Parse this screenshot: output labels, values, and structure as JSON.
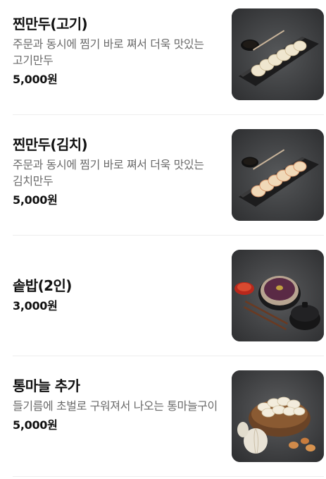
{
  "menu": {
    "items": [
      {
        "name": "찐만두(고기)",
        "description": "주문과 동시에 찜기 바로 쪄서 더욱 맛있는 고기만두",
        "price": "5,000원",
        "image_icon": "steamed-dumplings-meat-photo"
      },
      {
        "name": "찐만두(김치)",
        "description": "주문과 동시에 찜기 바로 쪄서 더욱 맛있는 김치만두",
        "price": "5,000원",
        "image_icon": "steamed-dumplings-kimchi-photo"
      },
      {
        "name": "솥밥(2인)",
        "price": "3,000원",
        "image_icon": "pot-rice-photo"
      },
      {
        "name": "통마늘 추가",
        "description": "들기름에 초벌로 구워져서 나오는 통마늘구이",
        "price": "5,000원",
        "image_icon": "whole-garlic-photo"
      }
    ]
  },
  "colors": {
    "text_primary": "#111111",
    "text_secondary": "#6b6b6b",
    "divider": "#eeeeee",
    "photo_background": "#3a3b3d"
  }
}
